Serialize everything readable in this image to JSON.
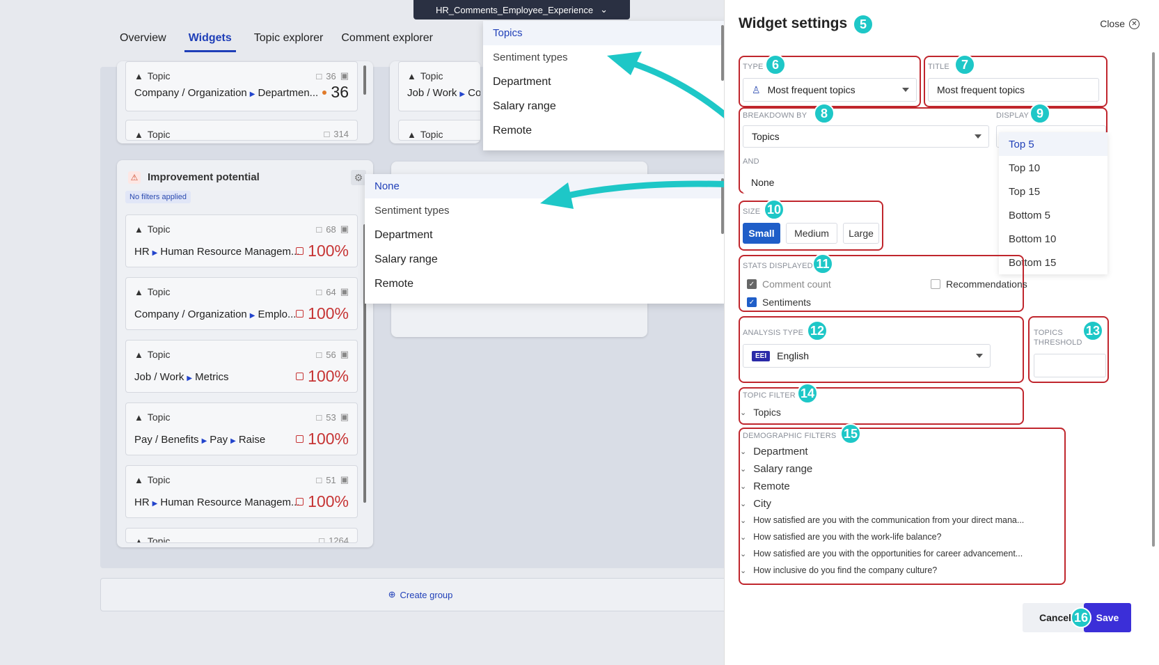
{
  "dataset": {
    "name": "HR_Comments_Employee_Experience"
  },
  "nav": {
    "tabs": [
      "Overview",
      "Widgets",
      "Topic explorer",
      "Comment explorer"
    ]
  },
  "top_cards": [
    {
      "label": "Topic",
      "count": "36",
      "path": [
        "Company / Organization",
        "Departmen..."
      ],
      "value": "36"
    },
    {
      "label": "Topic",
      "path": [
        "Job / Work",
        "Com"
      ]
    }
  ],
  "top_partial": {
    "label": "Topic",
    "count": "314"
  },
  "improvement": {
    "title": "Improvement potential",
    "filter_badge": "No filters applied",
    "items": [
      {
        "label": "Topic",
        "count": "68",
        "path": [
          "HR",
          "Human Resource Managem..."
        ],
        "value": "100%"
      },
      {
        "label": "Topic",
        "count": "64",
        "path": [
          "Company / Organization",
          "Emplo..."
        ],
        "value": "100%"
      },
      {
        "label": "Topic",
        "count": "56",
        "path": [
          "Job / Work",
          "Metrics"
        ],
        "value": "100%"
      },
      {
        "label": "Topic",
        "count": "53",
        "path": [
          "Pay / Benefits",
          "Pay",
          "Raise"
        ],
        "value": "100%"
      },
      {
        "label": "Topic",
        "count": "51",
        "path": [
          "HR",
          "Human Resource Managem..."
        ],
        "value": "100%"
      }
    ],
    "partial": {
      "label": "Topic",
      "count": "1264"
    }
  },
  "create_group": "Create group",
  "breakdown_dropdown": {
    "items": [
      "Topics",
      "Sentiment types",
      "Department",
      "Salary range",
      "Remote"
    ],
    "selected": "Topics"
  },
  "and_dropdown": {
    "items": [
      "None",
      "Sentiment types",
      "Department",
      "Salary range",
      "Remote"
    ],
    "selected": "None"
  },
  "panel": {
    "title": "Widget settings",
    "close": "Close",
    "type": {
      "label": "TYPE",
      "value": "Most frequent topics"
    },
    "title_field": {
      "label": "TITLE",
      "value": "Most frequent topics"
    },
    "breakdown": {
      "label": "BREAKDOWN BY",
      "value": "Topics"
    },
    "and_field": {
      "label": "AND",
      "value": "None"
    },
    "display": {
      "label": "DISPLAY",
      "options": [
        "Top 5",
        "Top 10",
        "Top 15",
        "Bottom 5",
        "Bottom 10",
        "Bottom 15"
      ],
      "selected": "Top 5"
    },
    "size": {
      "label": "SIZE",
      "options": [
        "Small",
        "Medium",
        "Large"
      ],
      "selected": "Small"
    },
    "stats": {
      "label": "STATS DISPLAYED",
      "comment_count": "Comment count",
      "recommendations": "Recommendations",
      "sentiments": "Sentiments"
    },
    "analysis": {
      "label": "ANALYSIS TYPE",
      "badge": "EEI",
      "value": "English"
    },
    "threshold": {
      "label1": "TOPICS",
      "label2": "THRESHOLD",
      "value": ""
    },
    "topic_filter": {
      "label": "TOPIC FILTER",
      "value": "Topics"
    },
    "demographic": {
      "label": "DEMOGRAPHIC FILTERS",
      "items": [
        "Department",
        "Salary range",
        "Remote",
        "City",
        "How satisfied are you with the communication from your direct mana...",
        "How satisfied are you with the work-life balance?",
        "How satisfied are you with the opportunities for career advancement...",
        "How inclusive do you find the company culture?"
      ]
    },
    "cancel": "Cancel",
    "save": "Save"
  },
  "callouts": [
    "5",
    "6",
    "7",
    "8",
    "9",
    "10",
    "11",
    "12",
    "13",
    "14",
    "15",
    "16"
  ],
  "colors": {
    "accent": "#1f3fb8",
    "callout": "#1ec7c7",
    "highlight": "#c0262d",
    "save": "#3b2fd8"
  }
}
